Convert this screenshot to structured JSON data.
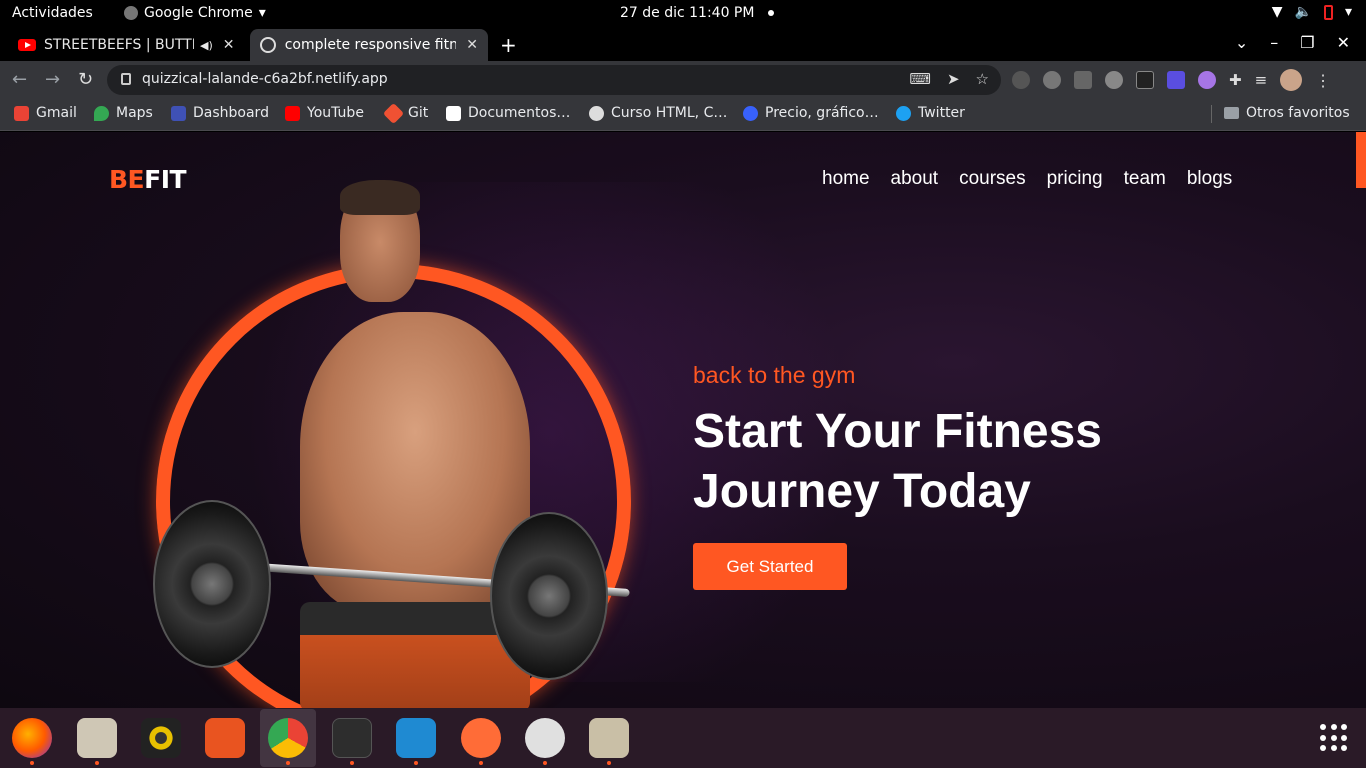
{
  "system_bar": {
    "activities": "Actividades",
    "app_name": "Google Chrome",
    "clock": "27 de dic  11:40 PM"
  },
  "tabs": [
    {
      "label": "STREETBEEFS | BUTTE",
      "icon": "youtube-icon",
      "audio": "🔊"
    },
    {
      "label": "complete responsive fitne",
      "icon": "globe-icon",
      "active": true
    }
  ],
  "address_bar": {
    "url": "quizzical-lalande-c6a2bf.netlify.app"
  },
  "bookmarks": [
    {
      "label": "Gmail",
      "color": "#ea4335"
    },
    {
      "label": "Maps",
      "color": "#34a853"
    },
    {
      "label": "Dashboard",
      "color": "#3f51b5"
    },
    {
      "label": "YouTube",
      "color": "#ff0000"
    },
    {
      "label": "Git",
      "color": "#f05133"
    },
    {
      "label": "Documentos…",
      "color": "#ffffff"
    },
    {
      "label": "Curso HTML, C…",
      "color": "#dddddd"
    },
    {
      "label": "Precio, gráfico…",
      "color": "#3861fb"
    },
    {
      "label": "Twitter",
      "color": "#1da1f2"
    },
    {
      "label": "Otros favoritos",
      "color": "#9aa0a6"
    }
  ],
  "site": {
    "logo_accent": "BE",
    "logo_main": "FIT",
    "nav": [
      "home",
      "about",
      "courses",
      "pricing",
      "team",
      "blogs"
    ],
    "eyebrow": "back to the gym",
    "headline": "Start Your Fitness Journey Today",
    "cta": "Get Started",
    "accent_color": "#ff5722"
  },
  "dock": [
    "firefox-icon",
    "files-icon",
    "rhythmbox-icon",
    "software-center-icon",
    "chrome-icon",
    "terminal-icon",
    "vscode-icon",
    "postman-icon",
    "app-installer-icon",
    "archive-manager-icon"
  ]
}
